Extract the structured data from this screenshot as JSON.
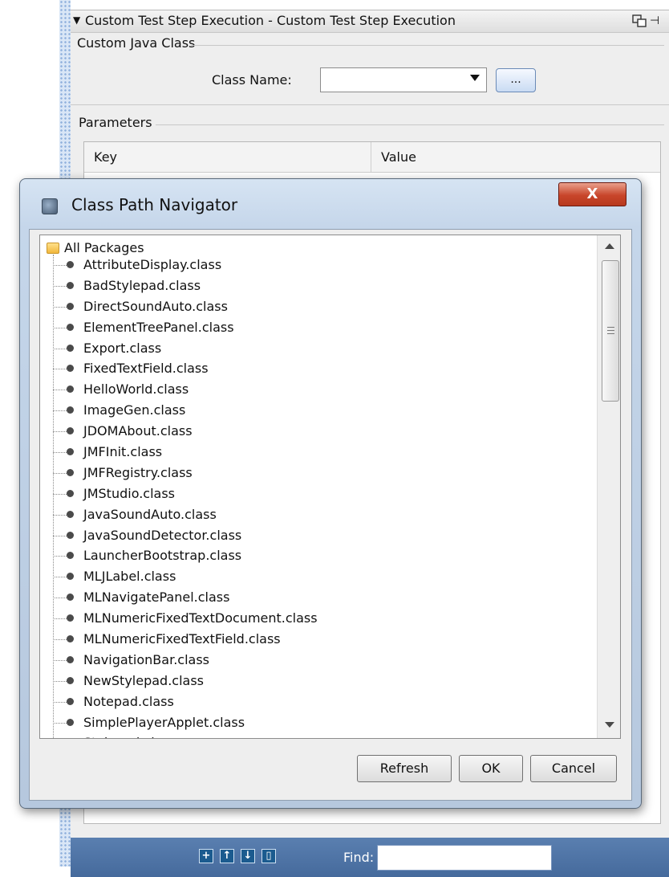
{
  "panel": {
    "title": "Custom Test Step Execution - Custom Test Step Execution",
    "custom_java_class_label": "Custom Java Class",
    "class_name_label": "Class Name:",
    "class_name_value": "",
    "browse_label": "...",
    "parameters_label": "Parameters",
    "table_headers": [
      "Key",
      "Value"
    ],
    "find_label": "Find:",
    "find_value": ""
  },
  "dialog": {
    "title": "Class Path Navigator",
    "close_label": "X",
    "root_label": "All Packages",
    "items": [
      "AttributeDisplay.class",
      "BadStylepad.class",
      "DirectSoundAuto.class",
      "ElementTreePanel.class",
      "Export.class",
      "FixedTextField.class",
      "HelloWorld.class",
      "ImageGen.class",
      "JDOMAbout.class",
      "JMFInit.class",
      "JMFRegistry.class",
      "JMStudio.class",
      "JavaSoundAuto.class",
      "JavaSoundDetector.class",
      "LauncherBootstrap.class",
      "MLJLabel.class",
      "MLNavigatePanel.class",
      "MLNumericFixedTextDocument.class",
      "MLNumericFixedTextField.class",
      "NavigationBar.class",
      "NewStylepad.class",
      "Notepad.class",
      "SimplePlayerApplet.class",
      "Stylepad.class"
    ],
    "buttons": {
      "refresh": "Refresh",
      "ok": "OK",
      "cancel": "Cancel"
    }
  },
  "icons": {
    "collapse": "triangle-down-icon",
    "float": "float-window-icon",
    "add": "add-icon",
    "move_up": "arrow-up-icon",
    "move_down": "arrow-down-icon",
    "delete": "trash-icon",
    "folder": "folder-icon",
    "leaf": "class-leaf-icon"
  }
}
